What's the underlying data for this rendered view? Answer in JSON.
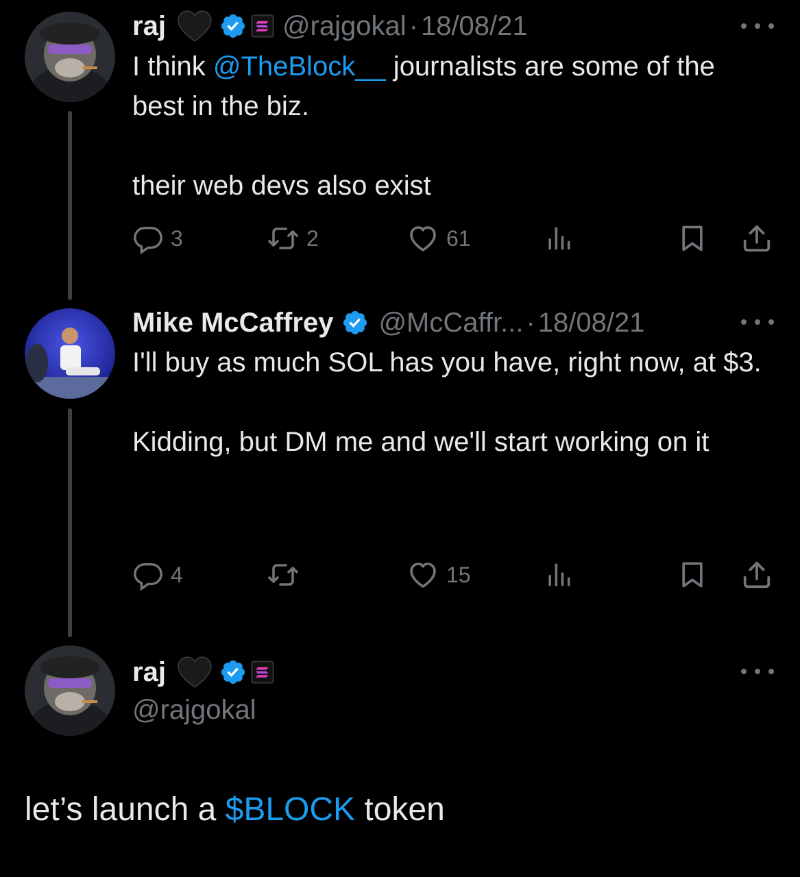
{
  "tweets": [
    {
      "name": "raj",
      "heart": "🖤",
      "handle": "@rajgokal",
      "dot": "·",
      "date": "18/08/21",
      "text_before": "I think ",
      "mention": "@TheBlock__",
      "text_after": " journalists are some of the best in the biz.\n\ntheir web devs also exist",
      "replies": "3",
      "retweets": "2",
      "likes": "61"
    },
    {
      "name": "Mike McCaffrey",
      "handle": "@McCaffr...",
      "dot": "·",
      "date": "18/08/21",
      "text": "I'll buy as much SOL has you have, right now, at $3.\n\nKidding, but DM me and we'll start working on it",
      "replies": "4",
      "retweets": "",
      "likes": "15"
    }
  ],
  "main_tweet": {
    "name": "raj",
    "heart": "🖤",
    "handle": "@rajgokal",
    "text_before": "let’s launch a ",
    "cashtag": "$BLOCK",
    "text_after": " token"
  },
  "icons": {
    "reply": "reply-icon",
    "retweet": "retweet-icon",
    "like": "heart-icon",
    "views": "views-icon",
    "bookmark": "bookmark-icon",
    "share": "share-icon",
    "verified": "verified-badge-icon",
    "more": "more-icon"
  },
  "colors": {
    "background": "#000000",
    "text": "#e7e9ea",
    "secondary": "#71767b",
    "accent": "#1d9bf0"
  }
}
